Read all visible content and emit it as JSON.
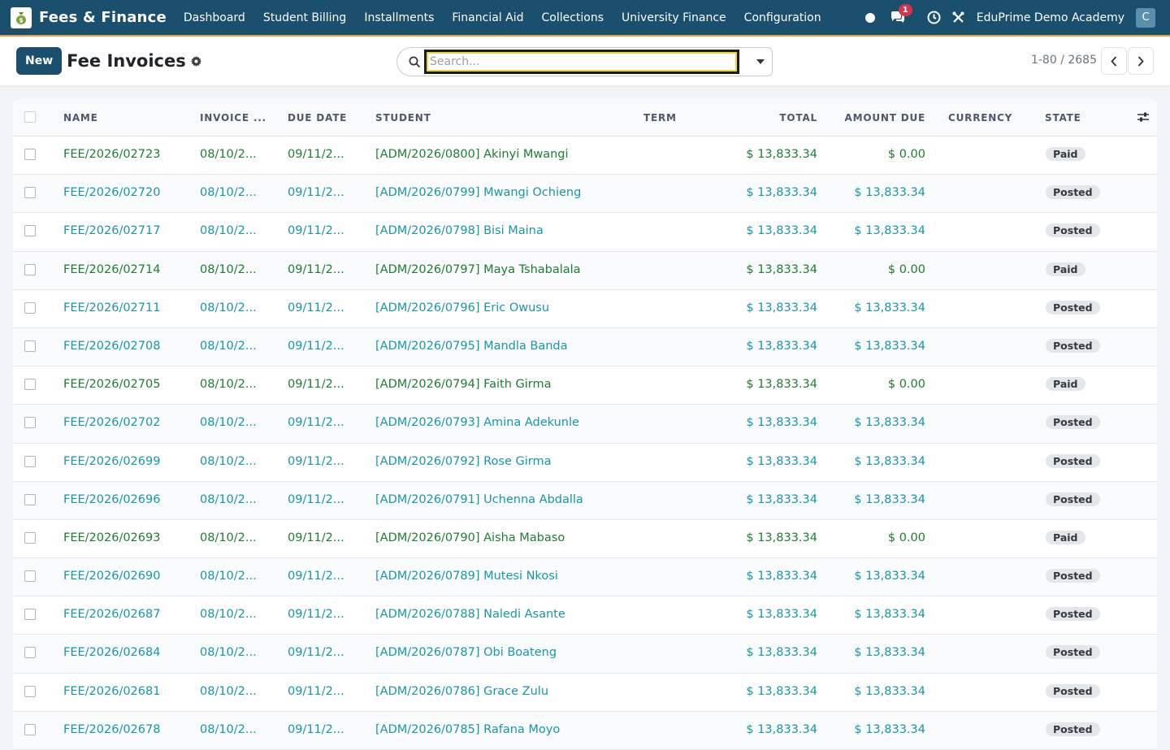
{
  "navbar": {
    "brand": "Fees & Finance",
    "menu": [
      "Dashboard",
      "Student Billing",
      "Installments",
      "Financial Aid",
      "Collections",
      "University Finance",
      "Configuration"
    ],
    "chat_badge": "1",
    "company": "EduPrime Demo Academy",
    "avatar_letter": "C",
    "accent_color": "#1b4f6e"
  },
  "control": {
    "new_label": "New",
    "title": "Fee Invoices",
    "search_placeholder": "Search...",
    "pager": "1-80 / 2685"
  },
  "table": {
    "headers": {
      "name": "NAME",
      "invoice": "INVOICE ...",
      "due": "DUE DATE",
      "student": "STUDENT",
      "term": "TERM",
      "total": "TOTAL",
      "amount_due": "AMOUNT DUE",
      "currency": "CURRENCY",
      "state": "STATE"
    },
    "rows": [
      {
        "name": "FEE/2026/02723",
        "invoice": "08/10/2...",
        "due": "09/11/2...",
        "student": "[ADM/2026/0800] Akinyi Mwangi",
        "total": "$ 13,833.34",
        "amount_due": "$ 0.00",
        "state": "Paid"
      },
      {
        "name": "FEE/2026/02720",
        "invoice": "08/10/2...",
        "due": "09/11/2...",
        "student": "[ADM/2026/0799] Mwangi Ochieng",
        "total": "$ 13,833.34",
        "amount_due": "$ 13,833.34",
        "state": "Posted"
      },
      {
        "name": "FEE/2026/02717",
        "invoice": "08/10/2...",
        "due": "09/11/2...",
        "student": "[ADM/2026/0798] Bisi Maina",
        "total": "$ 13,833.34",
        "amount_due": "$ 13,833.34",
        "state": "Posted"
      },
      {
        "name": "FEE/2026/02714",
        "invoice": "08/10/2...",
        "due": "09/11/2...",
        "student": "[ADM/2026/0797] Maya Tshabalala",
        "total": "$ 13,833.34",
        "amount_due": "$ 0.00",
        "state": "Paid"
      },
      {
        "name": "FEE/2026/02711",
        "invoice": "08/10/2...",
        "due": "09/11/2...",
        "student": "[ADM/2026/0796] Eric Owusu",
        "total": "$ 13,833.34",
        "amount_due": "$ 13,833.34",
        "state": "Posted"
      },
      {
        "name": "FEE/2026/02708",
        "invoice": "08/10/2...",
        "due": "09/11/2...",
        "student": "[ADM/2026/0795] Mandla Banda",
        "total": "$ 13,833.34",
        "amount_due": "$ 13,833.34",
        "state": "Posted"
      },
      {
        "name": "FEE/2026/02705",
        "invoice": "08/10/2...",
        "due": "09/11/2...",
        "student": "[ADM/2026/0794] Faith Girma",
        "total": "$ 13,833.34",
        "amount_due": "$ 0.00",
        "state": "Paid"
      },
      {
        "name": "FEE/2026/02702",
        "invoice": "08/10/2...",
        "due": "09/11/2...",
        "student": "[ADM/2026/0793] Amina Adekunle",
        "total": "$ 13,833.34",
        "amount_due": "$ 13,833.34",
        "state": "Posted"
      },
      {
        "name": "FEE/2026/02699",
        "invoice": "08/10/2...",
        "due": "09/11/2...",
        "student": "[ADM/2026/0792] Rose Girma",
        "total": "$ 13,833.34",
        "amount_due": "$ 13,833.34",
        "state": "Posted"
      },
      {
        "name": "FEE/2026/02696",
        "invoice": "08/10/2...",
        "due": "09/11/2...",
        "student": "[ADM/2026/0791] Uchenna Abdalla",
        "total": "$ 13,833.34",
        "amount_due": "$ 13,833.34",
        "state": "Posted"
      },
      {
        "name": "FEE/2026/02693",
        "invoice": "08/10/2...",
        "due": "09/11/2...",
        "student": "[ADM/2026/0790] Aisha Mabaso",
        "total": "$ 13,833.34",
        "amount_due": "$ 0.00",
        "state": "Paid"
      },
      {
        "name": "FEE/2026/02690",
        "invoice": "08/10/2...",
        "due": "09/11/2...",
        "student": "[ADM/2026/0789] Mutesi Nkosi",
        "total": "$ 13,833.34",
        "amount_due": "$ 13,833.34",
        "state": "Posted"
      },
      {
        "name": "FEE/2026/02687",
        "invoice": "08/10/2...",
        "due": "09/11/2...",
        "student": "[ADM/2026/0788] Naledi Asante",
        "total": "$ 13,833.34",
        "amount_due": "$ 13,833.34",
        "state": "Posted"
      },
      {
        "name": "FEE/2026/02684",
        "invoice": "08/10/2...",
        "due": "09/11/2...",
        "student": "[ADM/2026/0787] Obi Boateng",
        "total": "$ 13,833.34",
        "amount_due": "$ 13,833.34",
        "state": "Posted"
      },
      {
        "name": "FEE/2026/02681",
        "invoice": "08/10/2...",
        "due": "09/11/2...",
        "student": "[ADM/2026/0786] Grace Zulu",
        "total": "$ 13,833.34",
        "amount_due": "$ 13,833.34",
        "state": "Posted"
      },
      {
        "name": "FEE/2026/02678",
        "invoice": "08/10/2...",
        "due": "09/11/2...",
        "student": "[ADM/2026/0785] Rafana Moyo",
        "total": "$ 13,833.34",
        "amount_due": "$ 13,833.34",
        "state": "Posted"
      }
    ]
  }
}
